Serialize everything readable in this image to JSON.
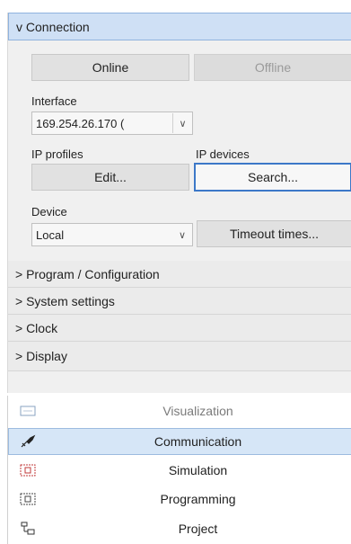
{
  "connection": {
    "header": "v Connection",
    "online_label": "Online",
    "offline_label": "Offline",
    "interface_label": "Interface",
    "interface_value": "169.254.26.170 (",
    "ip_profiles_label": "IP profiles",
    "ip_devices_label": "IP devices",
    "edit_label": "Edit...",
    "search_label": "Search...",
    "device_label": "Device",
    "device_value": "Local",
    "timeout_label": "Timeout times..."
  },
  "sections": [
    {
      "label": "> Program / Configuration"
    },
    {
      "label": "> System settings"
    },
    {
      "label": "> Clock"
    },
    {
      "label": "> Display"
    }
  ],
  "display_items": [
    {
      "label": "Visualization",
      "icon": "visualization-icon"
    },
    {
      "label": "Communication",
      "icon": "communication-icon"
    },
    {
      "label": "Simulation",
      "icon": "simulation-icon"
    },
    {
      "label": "Programming",
      "icon": "programming-icon"
    },
    {
      "label": "Project",
      "icon": "project-icon"
    }
  ],
  "colors": {
    "accent": "#3c78c8",
    "header_active": "#cfe0f5",
    "selected_row": "#d6e6f7"
  }
}
